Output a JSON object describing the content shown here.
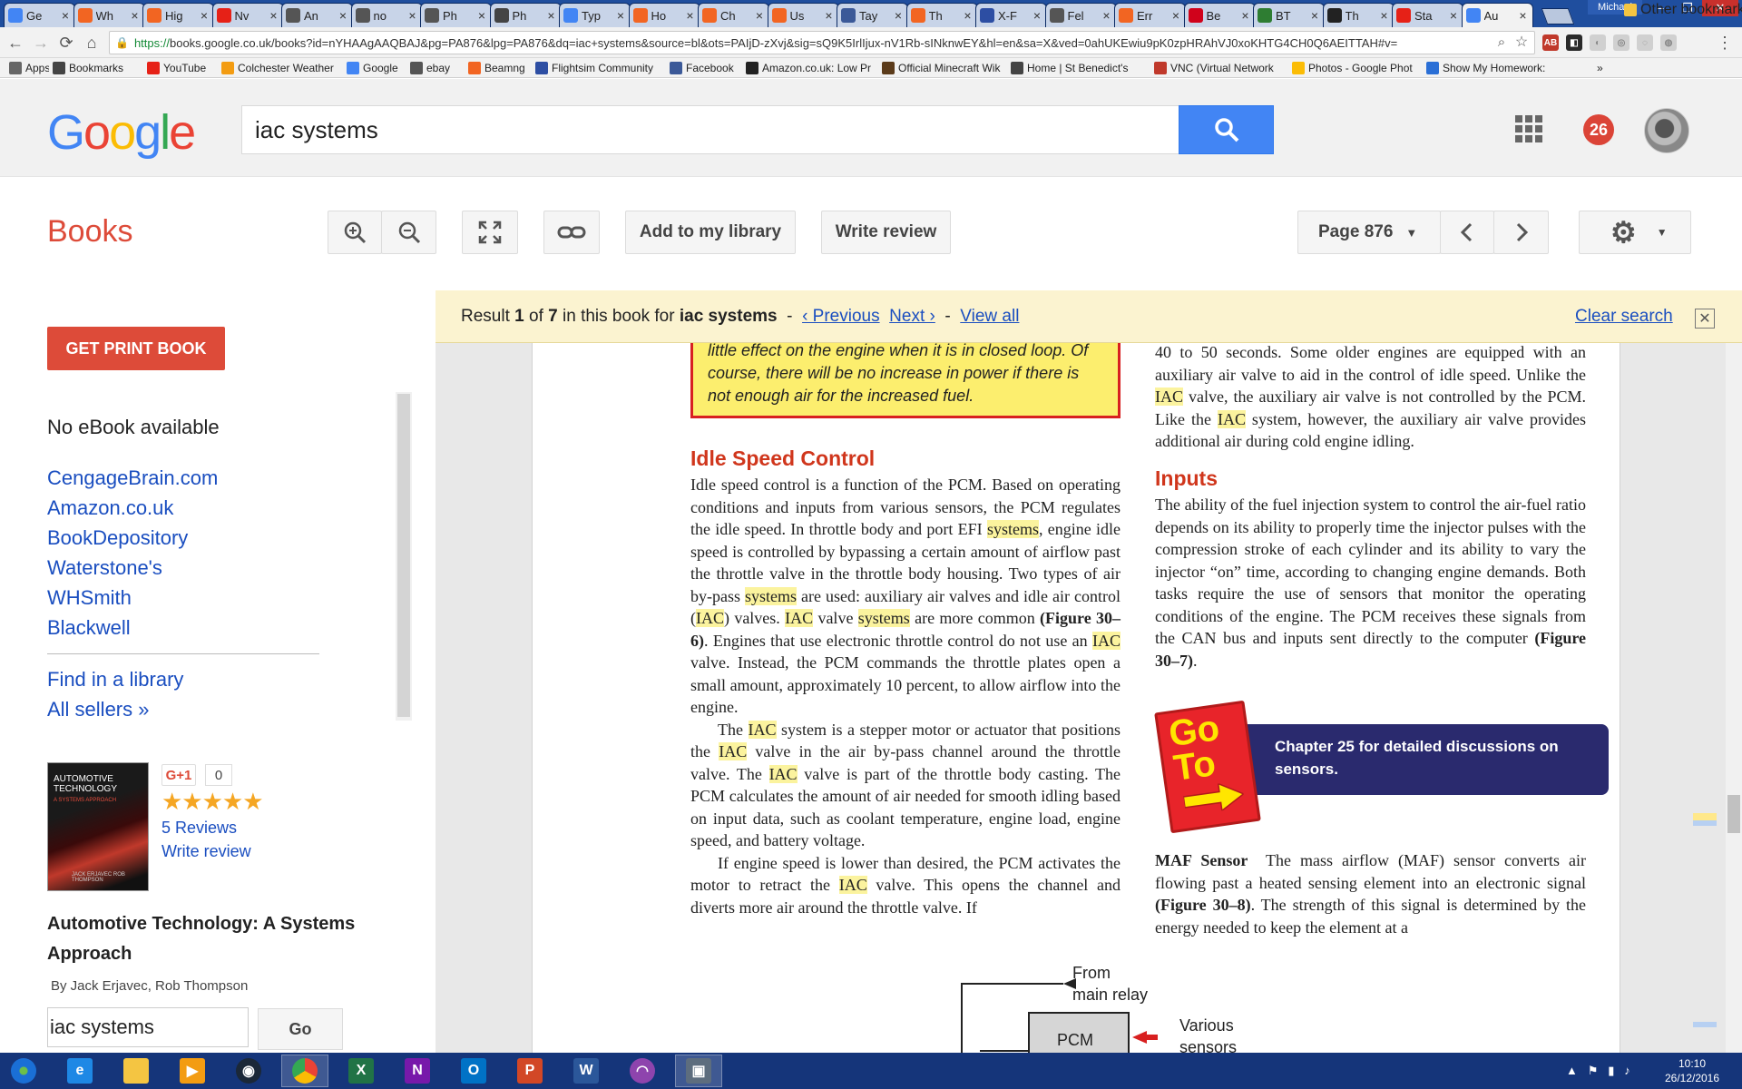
{
  "browser": {
    "tabs": [
      {
        "label": "Ge",
        "fav": "#4285f4",
        "icon": "google-icon"
      },
      {
        "label": "Wh",
        "fav": "#f26522",
        "icon": "puzzle-icon"
      },
      {
        "label": "Hig",
        "fav": "#f26522",
        "icon": "puzzle-icon"
      },
      {
        "label": "Nv",
        "fav": "#e62117",
        "icon": "youtube-icon"
      },
      {
        "label": "An",
        "fav": "#555555",
        "icon": "wikipedia-icon"
      },
      {
        "label": "no",
        "fav": "#555555",
        "icon": "wikipedia-icon"
      },
      {
        "label": "Ph",
        "fav": "#555555",
        "icon": "wikipedia-icon"
      },
      {
        "label": "Ph",
        "fav": "#444444",
        "icon": "circle-icon"
      },
      {
        "label": "Typ",
        "fav": "#4285f4",
        "icon": "google-icon"
      },
      {
        "label": "Ho",
        "fav": "#f26522",
        "icon": "puzzle-icon"
      },
      {
        "label": "Ch",
        "fav": "#f26522",
        "icon": "puzzle-icon"
      },
      {
        "label": "Us",
        "fav": "#f26522",
        "icon": "puzzle-icon"
      },
      {
        "label": "Tay",
        "fav": "#3b5998",
        "icon": "facebook-icon"
      },
      {
        "label": "Th",
        "fav": "#f26522",
        "icon": "puzzle-icon"
      },
      {
        "label": "X-F",
        "fav": "#2d4ea3",
        "icon": "xplane-icon"
      },
      {
        "label": "Fel",
        "fav": "#555555",
        "icon": "wikipedia-icon"
      },
      {
        "label": "Err",
        "fav": "#f26522",
        "icon": "puzzle-icon"
      },
      {
        "label": "Be",
        "fav": "#d0021b",
        "icon": "sp-icon"
      },
      {
        "label": "BT",
        "fav": "#2e7d32",
        "icon": "bt-icon"
      },
      {
        "label": "Th",
        "fav": "#222222",
        "icon": "amazon-icon"
      },
      {
        "label": "Sta",
        "fav": "#e62117",
        "icon": "youtube-icon"
      },
      {
        "label": "Au",
        "fav": "#4285f4",
        "icon": "google-icon",
        "active": true
      }
    ],
    "window_user": "Michael",
    "url_https": "https://",
    "url_rest": "books.google.co.uk/books?id=nYHAAgAAQBAJ&pg=PA876&lpg=PA876&dq=iac+systems&source=bl&ots=PAIjD-zXvj&sig=sQ9K5IrlIjux-nV1Rb-sINknwEY&hl=en&sa=X&ved=0ahUKEwiu9pK0zpHRAhVJ0xoKHTG4CH0Q6AEITTAH#v=",
    "bookmarks": [
      {
        "label": "Apps",
        "color": "#666666",
        "icon": "apps-icon"
      },
      {
        "label": "Bookmarks",
        "color": "#444444",
        "icon": "star-icon"
      },
      {
        "label": "YouTube",
        "color": "#e62117",
        "icon": "youtube-icon"
      },
      {
        "label": "Colchester Weather",
        "color": "#f39c12",
        "icon": "sun-icon"
      },
      {
        "label": "Google",
        "color": "#4285f4",
        "icon": "google-icon"
      },
      {
        "label": "ebay",
        "color": "#555555",
        "icon": "bag-icon"
      },
      {
        "label": "Beamng",
        "color": "#f26522",
        "icon": "puzzle-icon"
      },
      {
        "label": "Flightsim Community",
        "color": "#2d4ea3",
        "icon": "plane-icon"
      },
      {
        "label": "Facebook",
        "color": "#3b5998",
        "icon": "facebook-icon"
      },
      {
        "label": "Amazon.co.uk: Low Pr",
        "color": "#222222",
        "icon": "amazon-icon"
      },
      {
        "label": "Official Minecraft Wik",
        "color": "#5b3b1a",
        "icon": "minecraft-icon"
      },
      {
        "label": "Home | St Benedict's",
        "color": "#444444",
        "icon": "home-icon"
      },
      {
        "label": "VNC (Virtual Network",
        "color": "#c0392b",
        "icon": "raspberry-icon"
      },
      {
        "label": "Photos - Google Phot",
        "color": "#fbbc05",
        "icon": "photos-icon"
      },
      {
        "label": "Show My Homework:",
        "color": "#2a6fd6",
        "icon": "homework-icon"
      }
    ],
    "other_bookmarks": "Other bookmarks"
  },
  "google": {
    "search_value": "iac systems",
    "notification_count": "26"
  },
  "books_bar": {
    "title": "Books",
    "add_library": "Add to my library",
    "write_review": "Write review",
    "page_label": "Page 876"
  },
  "sidebar": {
    "get_print_book": "GET PRINT BOOK",
    "no_ebook": "No eBook available",
    "sellers": [
      "CengageBrain.com",
      "Amazon.co.uk",
      "BookDepository",
      "Waterstone's",
      "WHSmith",
      "Blackwell"
    ],
    "find_library": "Find in a library",
    "all_sellers": "All sellers »",
    "cover_title": "AUTOMOTIVE TECHNOLOGY",
    "cover_subtitle": "A SYSTEMS APPROACH",
    "cover_authors": "JACK ERJAVEC   ROB THOMPSON",
    "gplus": "G+1",
    "gplus_count": "0",
    "stars": "★★★★★",
    "reviews": "5 Reviews",
    "write_review": "Write review",
    "book_title": "Automotive Technology: A Systems Approach",
    "authors": "By Jack Erjavec, Rob Thompson",
    "search_value": "iac systems",
    "go": "Go"
  },
  "result_bar": {
    "result_word": "Result",
    "current": "1",
    "of_word": "of",
    "total": "7",
    "in_book": "in this book for",
    "query": "iac systems",
    "previous": "‹ Previous",
    "next": "Next ›",
    "view_all": "View all",
    "clear_search": "Clear search"
  },
  "page": {
    "note": "little effect on the engine when it is in closed loop. Of course, there will be no increase in power if there is not enough air for the increased fuel.",
    "idle_heading": "Idle Speed Control",
    "inputs_heading": "Inputs",
    "goto_sign": "Go To",
    "goto_text": "Chapter 25 for detailed discussions on sensors.",
    "maf_label": "MAF Sensor",
    "diagram_from": "From",
    "diagram_main_relay": "main relay",
    "diagram_pcm": "PCM",
    "diagram_various": "Various",
    "diagram_sensors": "sensors"
  },
  "taskbar": {
    "clock_time": "10:10",
    "clock_date": "26/12/2016"
  }
}
